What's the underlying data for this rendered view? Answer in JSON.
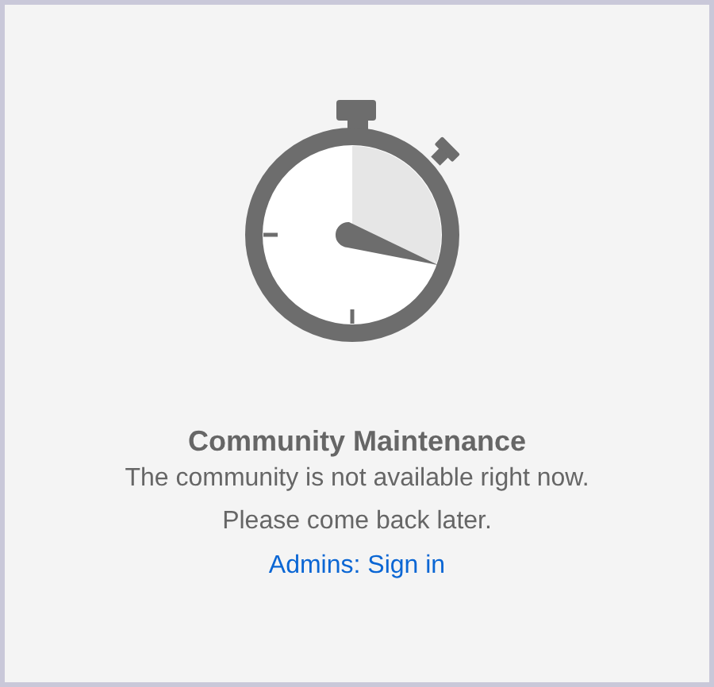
{
  "title": "Community Maintenance",
  "lines": [
    "The community is not available right now.",
    "Please come back later."
  ],
  "link": "Admins: Sign in"
}
